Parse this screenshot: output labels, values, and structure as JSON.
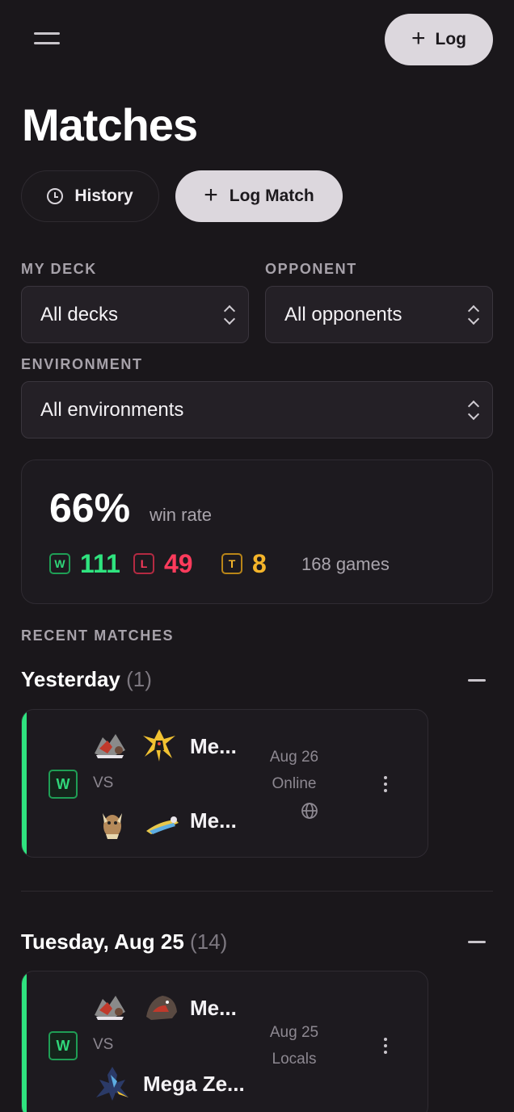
{
  "header": {
    "log_label": "Log"
  },
  "page": {
    "title": "Matches"
  },
  "actions": {
    "history_label": "History",
    "log_match_label": "Log Match"
  },
  "filters": {
    "my_deck": {
      "label": "MY DECK",
      "value": "All decks"
    },
    "opponent": {
      "label": "OPPONENT",
      "value": "All opponents"
    },
    "environment": {
      "label": "ENVIRONMENT",
      "value": "All environments"
    }
  },
  "stats": {
    "win_rate": "66%",
    "win_rate_label": "win rate",
    "wins": {
      "badge": "W",
      "value": "111",
      "color": "#2fe37f"
    },
    "losses": {
      "badge": "L",
      "value": "49",
      "color": "#ff3b5c"
    },
    "ties": {
      "badge": "T",
      "value": "8",
      "color": "#f5b52a"
    },
    "games": "168 games"
  },
  "recent": {
    "label": "RECENT MATCHES",
    "groups": [
      {
        "title": "Yesterday",
        "count": "(1)",
        "matches": [
          {
            "result": "W",
            "vs": "VS",
            "my_deck": "Me...",
            "opp_deck": "Me...",
            "date": "Aug 26",
            "environment": "Online",
            "env_icon": "globe-icon"
          }
        ]
      },
      {
        "title": "Tuesday, Aug 25",
        "count": "(14)",
        "matches": [
          {
            "result": "W",
            "vs": "VS",
            "my_deck": "Me...",
            "opp_deck": "Mega Ze...",
            "date": "Aug 25",
            "environment": "Locals"
          }
        ]
      }
    ]
  },
  "colors": {
    "accent_win": "#2fe37f",
    "background": "#1a171b",
    "button_light": "#dcd7dd"
  }
}
